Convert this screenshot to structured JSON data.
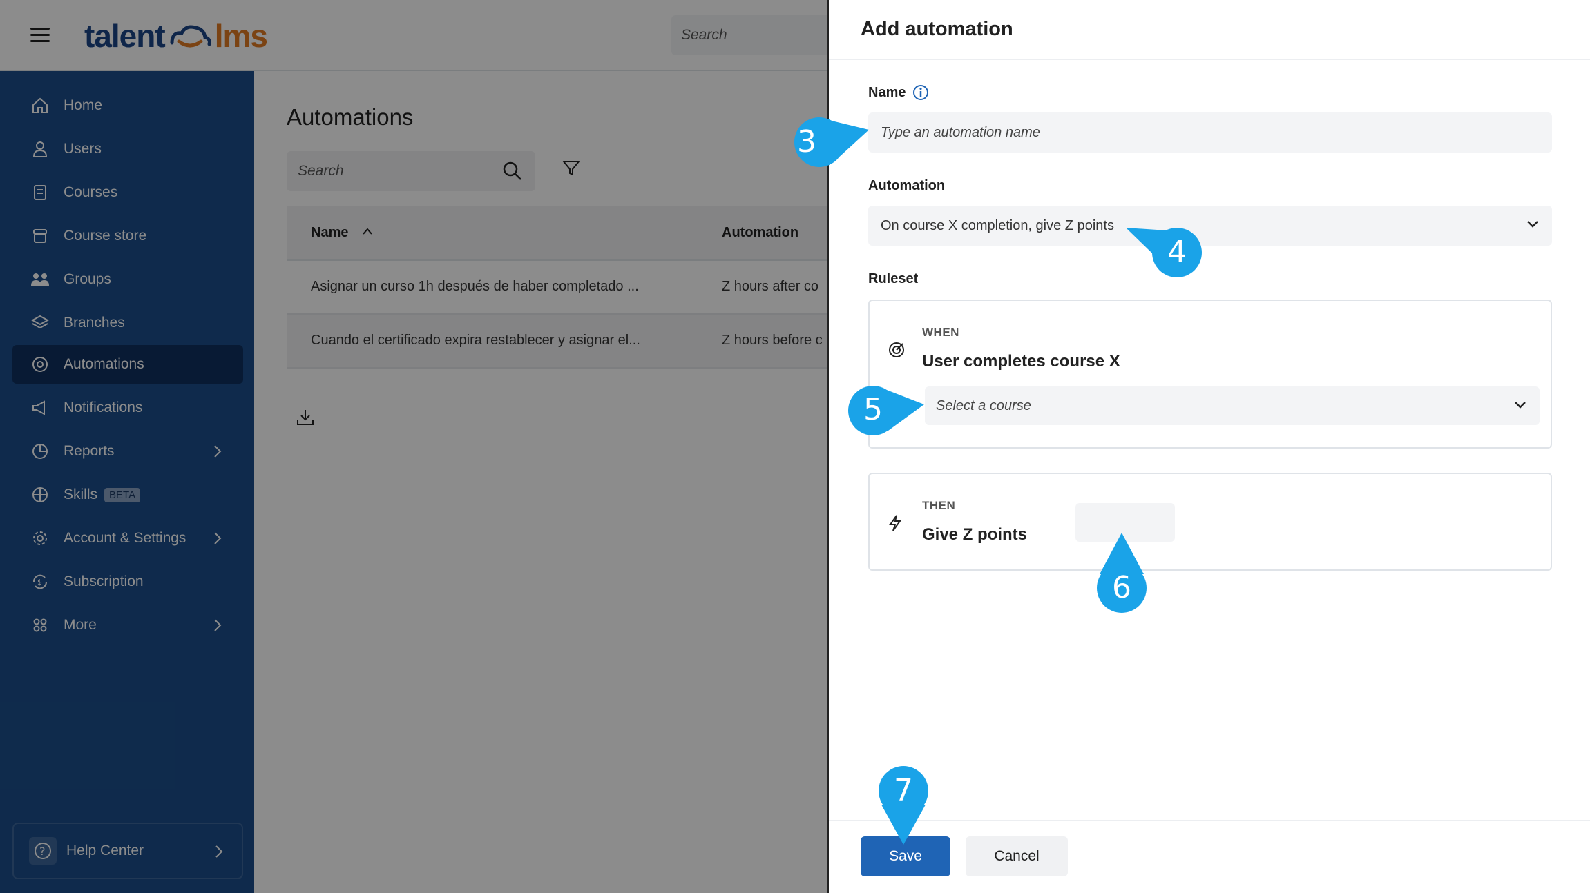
{
  "topbar": {
    "logo_part1": "talent",
    "logo_part2": "lms",
    "search_placeholder": "Search"
  },
  "sidebar": {
    "items": [
      {
        "label": "Home",
        "icon": "home-icon"
      },
      {
        "label": "Users",
        "icon": "user-icon"
      },
      {
        "label": "Courses",
        "icon": "book-icon"
      },
      {
        "label": "Course store",
        "icon": "store-icon"
      },
      {
        "label": "Groups",
        "icon": "groups-icon"
      },
      {
        "label": "Branches",
        "icon": "layers-icon"
      },
      {
        "label": "Automations",
        "icon": "automation-icon",
        "active": true
      },
      {
        "label": "Notifications",
        "icon": "megaphone-icon"
      },
      {
        "label": "Reports",
        "icon": "pie-chart-icon"
      },
      {
        "label": "Skills",
        "icon": "skills-icon",
        "badge": "BETA"
      },
      {
        "label": "Account & Settings",
        "icon": "gear-icon"
      },
      {
        "label": "Subscription",
        "icon": "subscription-icon"
      },
      {
        "label": "More",
        "icon": "grid-icon"
      }
    ],
    "help_label": "Help Center"
  },
  "main": {
    "title": "Automations",
    "search_placeholder": "Search",
    "table": {
      "columns": [
        "Name",
        "Automation"
      ],
      "rows": [
        [
          "Asignar un curso 1h después de haber completado ...",
          "Z hours after co"
        ],
        [
          "Cuando el certificado expira restablecer y asignar el...",
          "Z hours before c"
        ]
      ]
    }
  },
  "panel": {
    "title": "Add automation",
    "name_label": "Name",
    "name_placeholder": "Type an automation name",
    "automation_label": "Automation",
    "automation_value": "On course X completion, give Z points",
    "ruleset_label": "Ruleset",
    "when_tag": "WHEN",
    "when_text": "User completes course X",
    "course_placeholder": "Select a course",
    "then_tag": "THEN",
    "then_text": "Give Z points",
    "save_label": "Save",
    "cancel_label": "Cancel"
  },
  "markers": [
    "3",
    "4",
    "5",
    "6",
    "7"
  ],
  "colors": {
    "sidebar_bg": "#1c4e8a",
    "sidebar_active": "#0f3160",
    "primary_button": "#1f64b5",
    "marker": "#1aa3e8",
    "logo_blue": "#1c4587",
    "logo_orange": "#e07b23"
  }
}
